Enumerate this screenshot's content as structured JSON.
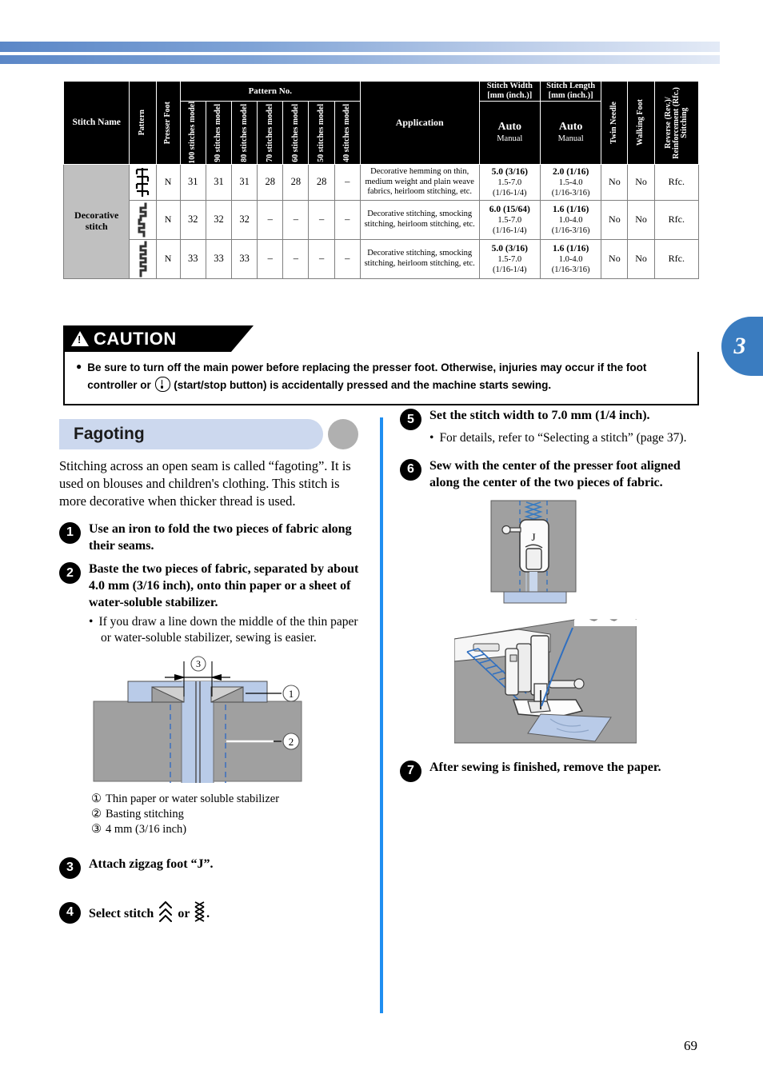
{
  "page": {
    "number": "69",
    "chapter_tab": "3"
  },
  "table": {
    "headers": {
      "stitch_name": "Stitch Name",
      "pattern": "Pattern",
      "presser_foot": "Presser Foot",
      "pattern_no": "Pattern No.",
      "models": [
        "100 stitches model",
        "90 stitches model",
        "80 stitches model",
        "70 stitches model",
        "60 stitches model",
        "50 stitches model",
        "40 stitches model"
      ],
      "application": "Application",
      "stitch_width": "Stitch Width [mm (inch.)]",
      "stitch_length": "Stitch Length [mm (inch.)]",
      "auto": "Auto",
      "manual": "Manual",
      "twin_needle": "Twin Needle",
      "walking_foot": "Walking Foot",
      "reverse": "Reverse (Rev.)/ Reinforcement (Rfc.) Stitching"
    },
    "group_name": "Decorative stitch",
    "rows": [
      {
        "pattern_icon": "decorative-stitch-ladder-icon",
        "presser_foot": "N",
        "models": [
          "31",
          "31",
          "31",
          "28",
          "28",
          "28",
          "–"
        ],
        "application": "Decorative hemming on thin, medium weight and plain weave fabrics, heirloom stitching, etc.",
        "width_auto": "5.0 (3/16)",
        "width_manual_mm": "1.5-7.0",
        "width_manual_in": "(1/16-1/4)",
        "length_auto": "2.0 (1/16)",
        "length_manual_mm": "1.5-4.0",
        "length_manual_in": "(1/16-3/16)",
        "twin_needle": "No",
        "walking_foot": "No",
        "reverse": "Rfc."
      },
      {
        "pattern_icon": "decorative-stitch-zigzag-step-icon",
        "presser_foot": "N",
        "models": [
          "32",
          "32",
          "32",
          "–",
          "–",
          "–",
          "–"
        ],
        "application": "Decorative stitching, smocking stitching, heirloom stitching, etc.",
        "width_auto": "6.0 (15/64)",
        "width_manual_mm": "1.5-7.0",
        "width_manual_in": "(1/16-1/4)",
        "length_auto": "1.6 (1/16)",
        "length_manual_mm": "1.0-4.0",
        "length_manual_in": "(1/16-3/16)",
        "twin_needle": "No",
        "walking_foot": "No",
        "reverse": "Rfc."
      },
      {
        "pattern_icon": "decorative-stitch-step-icon",
        "presser_foot": "N",
        "models": [
          "33",
          "33",
          "33",
          "–",
          "–",
          "–",
          "–"
        ],
        "application": "Decorative stitching, smocking stitching, heirloom stitching, etc.",
        "width_auto": "5.0 (3/16)",
        "width_manual_mm": "1.5-7.0",
        "width_manual_in": "(1/16-1/4)",
        "length_auto": "1.6 (1/16)",
        "length_manual_mm": "1.0-4.0",
        "length_manual_in": "(1/16-3/16)",
        "twin_needle": "No",
        "walking_foot": "No",
        "reverse": "Rfc."
      }
    ]
  },
  "caution": {
    "title": "CAUTION",
    "text_before_icon": "Be sure to turn off the main power before replacing the presser foot. Otherwise, injuries may occur if the foot controller or",
    "text_after_icon": "(start/stop button) is accidentally pressed and the machine starts sewing."
  },
  "section": {
    "title": "Fagoting",
    "intro": "Stitching across an open seam is called “fagoting”. It is used on blouses and children's clothing. This stitch is more decorative when thicker thread is used."
  },
  "steps": {
    "s1": {
      "num": "1",
      "title": "Use an iron to fold the two pieces of fabric along their seams."
    },
    "s2": {
      "num": "2",
      "title": "Baste the two pieces of fabric, separated by about 4.0 mm (3/16 inch), onto thin paper or a sheet of water-soluble stabilizer.",
      "bullets": [
        "If you draw a line down the middle of the thin paper or water-soluble stabilizer, sewing is easier."
      ]
    },
    "s3": {
      "num": "3",
      "title": "Attach zigzag foot “J”."
    },
    "s4": {
      "num": "4",
      "pre": "Select stitch",
      "mid": "or",
      "post": "."
    },
    "s5": {
      "num": "5",
      "title": "Set the stitch width to 7.0 mm (1/4 inch).",
      "bullets": [
        "For details, refer to “Selecting a stitch” (page 37)."
      ]
    },
    "s6": {
      "num": "6",
      "title": "Sew with the center of the presser foot aligned along the center of the two pieces of fabric."
    },
    "s7": {
      "num": "7",
      "title": "After sewing is finished, remove the paper."
    }
  },
  "figure_legend": [
    {
      "marker": "①",
      "label": "Thin paper or water soluble stabilizer"
    },
    {
      "marker": "②",
      "label": "Basting stitching"
    },
    {
      "marker": "③",
      "label": "4 mm (3/16 inch)"
    }
  ],
  "figure_callouts": {
    "c1": "①",
    "c2": "②",
    "c3": "③",
    "foot_label": "J"
  },
  "colors": {
    "accent_blue": "#1f8ef1",
    "tab_blue": "#3a7cc0",
    "heading_bar": "#ccd8ee",
    "heading_dot": "#b0b0b0",
    "fabric_gray": "#a0a0a0",
    "paper_blue": "#b9cbe8",
    "thread_blue": "#2f6fc0"
  }
}
